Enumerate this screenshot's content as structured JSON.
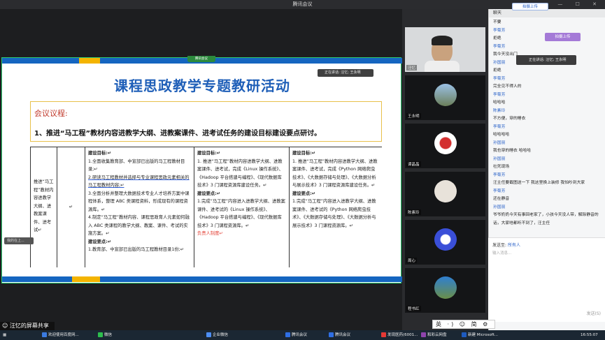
{
  "window": {
    "title": "腾讯会议"
  },
  "slide": {
    "title": "课程思政教学专题教研活动",
    "agenda_label": "会议议程:",
    "agenda_item": "1、推进“马工程”教材内容进教学大纲、进教案课件、进考试任务的建设目标建设要点研讨。",
    "col0": "推进“马工程”教材内容进教学大纲、进教案课件、进考试↵",
    "col1_mark": "↵",
    "col2_title": "建设目标:↵",
    "col2_1": "1.全面收集教育部、中宣部已出版的马工程教材目录;↵",
    "col2_2": "2.研读马工程教材并选择与专业课程思政元素相关的马工程教材内容;↵",
    "col2_3": "3.全面分析并整理大数据技术专业人才培养方案中课程体系，整理 ABC 类课程资料，形成现有的课程资源库。↵",
    "col2_4": "4.制定“马工程”教材内容、课程思政育人元素如何融入 ABC 类课程的教学大纲、教案、课件、考试的实施方案。↵",
    "col2_sub": "建设要点:↵",
    "col2_5": "1.教育部、中宣部已出版的马工程教材目录1份;↵",
    "col3_title": "建设目标:↵",
    "col3_1": "1. 推进“马工程”教材内容进教学大纲、进教案课件、进考试，完成《Linux 操作系统》、《Hadoop 平台搭建与编程》、《现代数据库技术》3 门课程资源库建设任务。↵",
    "col3_sub": "建设要点:↵",
    "col3_2": "1.完成“马工程”内容进入进教学大纲、进教案课件、进考试的《Linux 操作系统》、《Hadoop 平台搭建与编程》、《现代数据库技术》3 门课程资源库。↵",
    "col3_owner": "负责人制度↵",
    "col4_title": "建设目标:↵",
    "col4_1": "1. 推进“马工程”教材内容进教学大纲、进教案课件、进考试，完成《Python 网络爬虫技术》、《大数据存储与处理》、《大数据分析与展示技术》3 门课程资源库建设任务。↵",
    "col4_sub": "建设要点:↵",
    "col4_2": "1.完成“马工程”内容进入进教学大纲、进教案课件、进考试的《Python 网络爬虫技术》、《大数据存储与处理》、《大数据分析与展示技术》3 门课程资源库。↵"
  },
  "overlays": {
    "presenter_tag": "正在讲话: 汪忆; 王永明",
    "float_tab": "腾讯会议",
    "small_pill": "我的在上...",
    "share_label": "汪忆的屏幕共享"
  },
  "videos": [
    {
      "name": "汪忆"
    },
    {
      "name": "王永明"
    },
    {
      "name": "谭晶晶"
    },
    {
      "name": "陈素玲"
    },
    {
      "name": "周心"
    },
    {
      "name": "程书红"
    }
  ],
  "chat": {
    "header": "聊天",
    "upload_label": "拍摄上传",
    "speaking_tip": "正在讲话: 汪忆; 王永明",
    "messages": [
      {
        "name": "",
        "text": "不要"
      },
      {
        "name": "李菊芳",
        "text": "拒绝"
      },
      {
        "name": "李菊芳",
        "text": "我今天没出门"
      },
      {
        "name": "孙国丽",
        "text": "拒绝"
      },
      {
        "name": "李菊芳",
        "text": "完全见不得人的"
      },
      {
        "name": "李菊芳",
        "text": "哈哈哈"
      },
      {
        "name": "陈素玲",
        "text": "不方便，穿的睡衣"
      },
      {
        "name": "李菊芳",
        "text": "哈哈哈哈"
      },
      {
        "name": "孙国丽",
        "text": "我也穿的睡衣 哈哈哈"
      },
      {
        "name": "孙国丽",
        "text": "社死现场"
      },
      {
        "name": "李菊芳",
        "text": "汪主任要截图送一下 我这里换上装修 我怕吵到大家"
      },
      {
        "name": "李菊芳",
        "text": "还在静音"
      },
      {
        "name": "孙国丽",
        "text": "爷爷奶奶今天有事回老家了，小孩今天没人带，解除静音的话，大家啥都听不到了，汪主任"
      }
    ],
    "send_to_label": "发送至:",
    "send_to_value": "所有人",
    "input_placeholder": "输入消息...",
    "send_button": "发送(S)"
  },
  "ime": {
    "text": "英 ·) ☺ 简 ⚙"
  },
  "taskbar": {
    "items": [
      "欢迎使用百度网...",
      "微信",
      "企业微信",
      "腾讯会议",
      "腾讯会议",
      "发现医药(6001...",
      "和彩云网盘",
      "新建 Microsoft..."
    ],
    "clock": "16:55:07"
  },
  "colors": {
    "accent": "#1f5fb8",
    "green_border": "#2ecc71",
    "stripe_blue": "#1565c0",
    "stripe_yellow": "#f4b400"
  }
}
